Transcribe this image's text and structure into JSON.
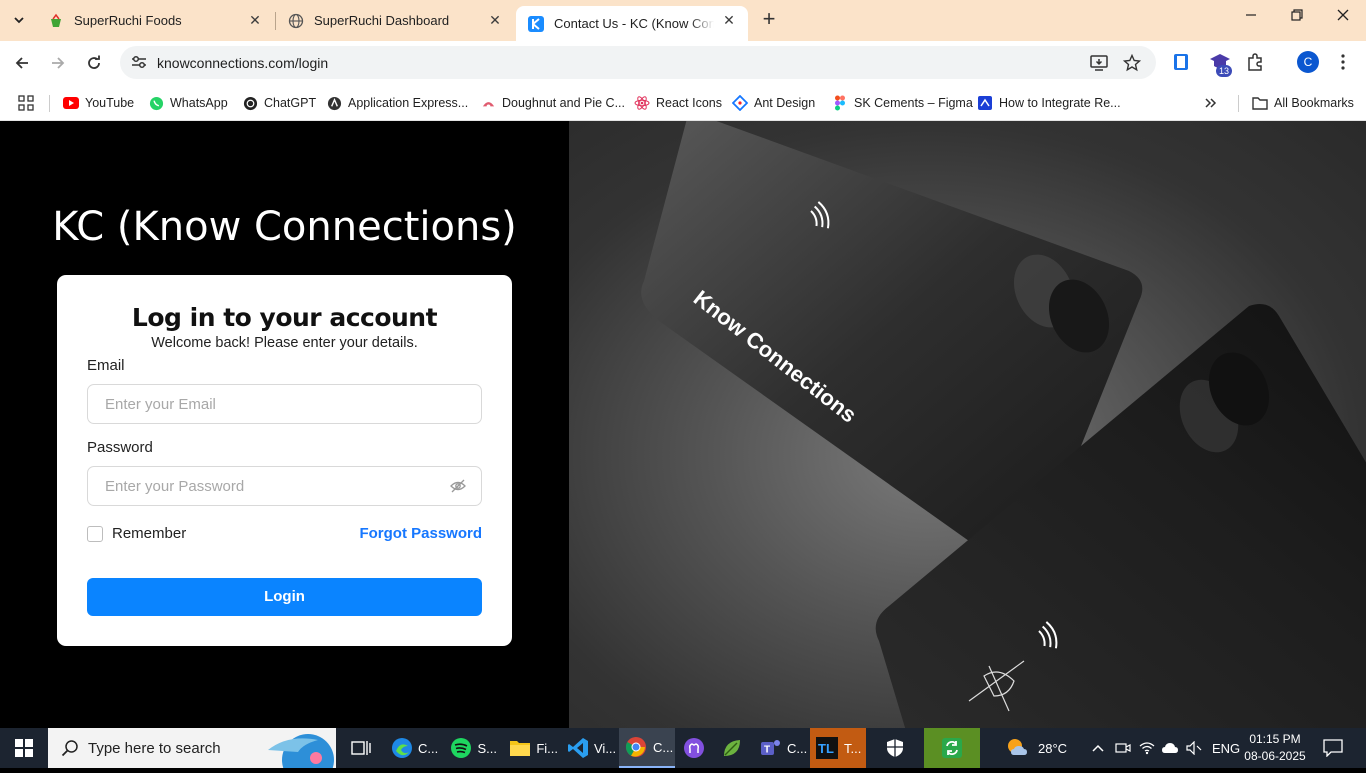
{
  "browser": {
    "tabs": [
      {
        "title": "SuperRuchi Foods",
        "favicon": "superruchi-icon"
      },
      {
        "title": "SuperRuchi Dashboard",
        "favicon": "globe-icon"
      },
      {
        "title": "Contact Us - KC (Know Connect",
        "favicon": "kc-icon",
        "active": true
      }
    ],
    "url": "knowconnections.com/login",
    "extension_badge": "13",
    "profile_initial": "C",
    "bookmarks": [
      {
        "label": "YouTube",
        "icon": "youtube-icon"
      },
      {
        "label": "WhatsApp",
        "icon": "whatsapp-icon"
      },
      {
        "label": "ChatGPT",
        "icon": "chatgpt-icon"
      },
      {
        "label": "Application Express...",
        "icon": "apex-icon"
      },
      {
        "label": "Doughnut and Pie C...",
        "icon": "chart-icon"
      },
      {
        "label": "React Icons",
        "icon": "react-icon"
      },
      {
        "label": "Ant Design",
        "icon": "antd-icon"
      },
      {
        "label": "SK Cements – Figma",
        "icon": "figma-icon"
      },
      {
        "label": "How to Integrate Re...",
        "icon": "article-icon"
      }
    ],
    "all_bookmarks": "All Bookmarks"
  },
  "page": {
    "brand": "KC (Know Connections)",
    "heading": "Log in to your account",
    "subheading": "Welcome back! Please enter your details.",
    "email_label": "Email",
    "email_placeholder": "Enter your Email",
    "password_label": "Password",
    "password_placeholder": "Enter your Password",
    "remember_label": "Remember",
    "forgot_label": "Forgot Password",
    "login_label": "Login",
    "card_text": "Know Connections",
    "colors": {
      "primary": "#0a84ff",
      "link": "#1677ff"
    }
  },
  "taskbar": {
    "search_placeholder": "Type here to search",
    "apps": [
      {
        "label": "C...",
        "icon": "edge-icon"
      },
      {
        "label": "S...",
        "icon": "spotify-icon"
      },
      {
        "label": "Fi...",
        "icon": "folder-icon"
      },
      {
        "label": "Vi...",
        "icon": "vscode-icon"
      },
      {
        "label": "C...",
        "icon": "chrome-icon"
      },
      {
        "label": "",
        "icon": "github-icon"
      },
      {
        "label": "",
        "icon": "leaf-icon"
      },
      {
        "label": "C...",
        "icon": "teams-icon"
      },
      {
        "label": "T...",
        "icon": "tl-icon"
      }
    ],
    "weather": "28°C",
    "language": "ENG",
    "time": "01:15 PM",
    "date": "08-06-2025"
  }
}
